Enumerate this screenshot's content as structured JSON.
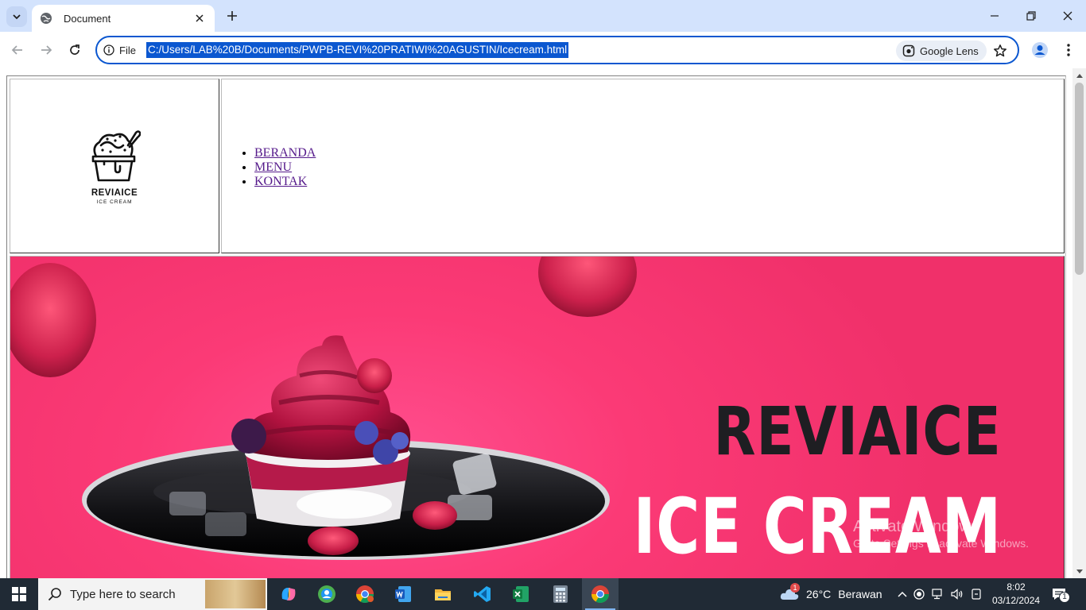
{
  "browser": {
    "tab_title": "Document",
    "site_info_label": "File",
    "url": "C:/Users/LAB%20B/Documents/PWPB-REVI%20PRATIWI%20AGUSTIN/Icecream.html",
    "lens_label": "Google Lens"
  },
  "page": {
    "logo": {
      "name": "REVIAICE",
      "subtitle": "ICE CREAM"
    },
    "nav": [
      {
        "label": "BERANDA"
      },
      {
        "label": "MENU"
      },
      {
        "label": "KONTAK"
      }
    ],
    "banner": {
      "title_line1": "REVIAICE",
      "title_line2": "ICE CREAM"
    }
  },
  "watermark": {
    "line1": "Activate Windows",
    "line2": "Go to Settings to activate Windows."
  },
  "taskbar": {
    "search_placeholder": "Type here to search",
    "weather_temp": "26°C",
    "weather_desc": "Berawan",
    "time": "8:02",
    "date": "03/12/2024",
    "notification_count": "1",
    "weather_badge": "1"
  },
  "colors": {
    "accent": "#0b57d0",
    "tabstrip": "#d3e3fd",
    "banner_pink": "#fb3a76",
    "taskbar": "#202a35"
  }
}
